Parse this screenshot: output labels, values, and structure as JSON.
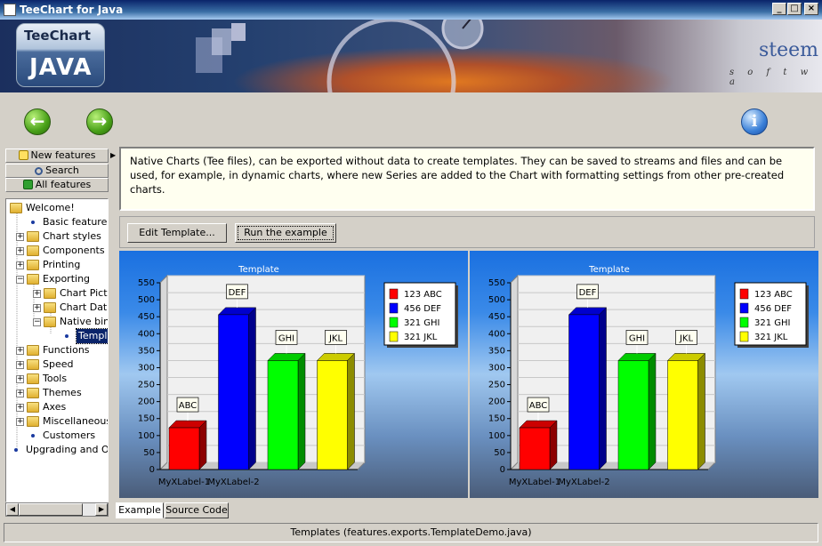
{
  "window": {
    "title": "TeeChart for Java",
    "buttons": [
      "_",
      "□",
      "×"
    ]
  },
  "banner": {
    "logo_line1": "TeeChart",
    "logo_line2": "JAVA",
    "brand": "steem",
    "brand_sub": "s o f t w a"
  },
  "nav": {
    "back_icon": "arrow-left-icon",
    "forward_icon": "arrow-right-icon",
    "info_icon": "info-icon",
    "info_glyph": "i",
    "back_glyph": "←",
    "forward_glyph": "→"
  },
  "sidebar": {
    "new_features": "New features",
    "search": "Search",
    "all_features": "All features",
    "tree": [
      {
        "label": "Welcome!",
        "kind": "folder-open",
        "level": 0
      },
      {
        "label": "Basic features",
        "kind": "leaf",
        "level": 1
      },
      {
        "label": "Chart styles",
        "kind": "folder",
        "level": 1
      },
      {
        "label": "Components",
        "kind": "folder",
        "level": 1
      },
      {
        "label": "Printing",
        "kind": "folder",
        "level": 1
      },
      {
        "label": "Exporting",
        "kind": "folder-open",
        "level": 1
      },
      {
        "label": "Chart Pictu",
        "kind": "folder",
        "level": 2
      },
      {
        "label": "Chart Data",
        "kind": "folder",
        "level": 2
      },
      {
        "label": "Native bina",
        "kind": "folder-open",
        "level": 2
      },
      {
        "label": "Templ",
        "kind": "leaf-selected",
        "level": 3
      },
      {
        "label": "Functions",
        "kind": "folder",
        "level": 1
      },
      {
        "label": "Speed",
        "kind": "folder",
        "level": 1
      },
      {
        "label": "Tools",
        "kind": "folder",
        "level": 1
      },
      {
        "label": "Themes",
        "kind": "folder",
        "level": 1
      },
      {
        "label": "Axes",
        "kind": "folder",
        "level": 1
      },
      {
        "label": "Miscellaneous",
        "kind": "folder",
        "level": 1
      },
      {
        "label": "Customers",
        "kind": "leaf",
        "level": 1
      },
      {
        "label": "Upgrading and Orc",
        "kind": "leaf",
        "level": 0
      }
    ]
  },
  "description": "Native Charts (Tee files), can be exported without data to create templates. They can be saved to streams and files and can be used, for example, in dynamic charts, where new Series are added to the Chart with formatting settings from other pre-created charts.",
  "toolbar": {
    "edit_template": "Edit Template...",
    "run_example": "Run the example"
  },
  "tabs": {
    "example": "Example",
    "source_code": "Source Code"
  },
  "status": "Templates  (features.exports.TemplateDemo.java)",
  "chart_data": [
    {
      "type": "bar",
      "title": "Template",
      "categories": [
        "ABC",
        "DEF",
        "GHI",
        "JKL"
      ],
      "values": [
        123,
        456,
        321,
        321
      ],
      "colors": [
        "#ff0000",
        "#0000ff",
        "#00ff00",
        "#ffff00"
      ],
      "x_tick_labels": [
        "MyXLabel-1",
        "MyXLabel-2"
      ],
      "legend": [
        "123 ABC",
        "456 DEF",
        "321 GHI",
        "321 JKL"
      ],
      "legend_position": "top-right",
      "ylim": [
        0,
        550
      ],
      "yticks": [
        0,
        50,
        100,
        150,
        200,
        250,
        300,
        350,
        400,
        450,
        500,
        550
      ],
      "grid": true
    },
    {
      "type": "bar",
      "title": "Template",
      "categories": [
        "ABC",
        "DEF",
        "GHI",
        "JKL"
      ],
      "values": [
        123,
        456,
        321,
        321
      ],
      "colors": [
        "#ff0000",
        "#0000ff",
        "#00ff00",
        "#ffff00"
      ],
      "x_tick_labels": [
        "MyXLabel-1",
        "MyXLabel-2"
      ],
      "legend": [
        "123 ABC",
        "456 DEF",
        "321 GHI",
        "321 JKL"
      ],
      "legend_position": "top-right",
      "ylim": [
        0,
        550
      ],
      "yticks": [
        0,
        50,
        100,
        150,
        200,
        250,
        300,
        350,
        400,
        450,
        500,
        550
      ],
      "grid": true
    }
  ]
}
